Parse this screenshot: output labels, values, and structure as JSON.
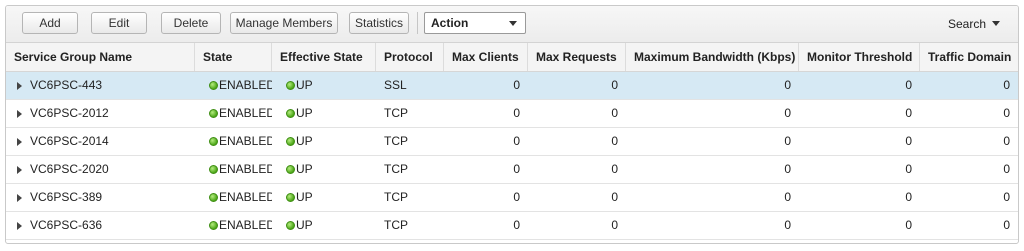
{
  "toolbar": {
    "add_label": "Add",
    "edit_label": "Edit",
    "delete_label": "Delete",
    "manage_members_label": "Manage Members",
    "statistics_label": "Statistics",
    "action_label": "Action",
    "search_label": "Search"
  },
  "table": {
    "columns": [
      "Service Group Name",
      "State",
      "Effective State",
      "Protocol",
      "Max Clients",
      "Max Requests",
      "Maximum Bandwidth (Kbps)",
      "Monitor Threshold",
      "Traffic Domain"
    ],
    "rows": [
      {
        "name": "VC6PSC-443",
        "state": "ENABLED",
        "effective_state": "UP",
        "protocol": "SSL",
        "max_clients": "0",
        "max_requests": "0",
        "max_bandwidth": "0",
        "monitor_threshold": "0",
        "traffic_domain": "0",
        "selected": true
      },
      {
        "name": "VC6PSC-2012",
        "state": "ENABLED",
        "effective_state": "UP",
        "protocol": "TCP",
        "max_clients": "0",
        "max_requests": "0",
        "max_bandwidth": "0",
        "monitor_threshold": "0",
        "traffic_domain": "0",
        "selected": false
      },
      {
        "name": "VC6PSC-2014",
        "state": "ENABLED",
        "effective_state": "UP",
        "protocol": "TCP",
        "max_clients": "0",
        "max_requests": "0",
        "max_bandwidth": "0",
        "monitor_threshold": "0",
        "traffic_domain": "0",
        "selected": false
      },
      {
        "name": "VC6PSC-2020",
        "state": "ENABLED",
        "effective_state": "UP",
        "protocol": "TCP",
        "max_clients": "0",
        "max_requests": "0",
        "max_bandwidth": "0",
        "monitor_threshold": "0",
        "traffic_domain": "0",
        "selected": false
      },
      {
        "name": "VC6PSC-389",
        "state": "ENABLED",
        "effective_state": "UP",
        "protocol": "TCP",
        "max_clients": "0",
        "max_requests": "0",
        "max_bandwidth": "0",
        "monitor_threshold": "0",
        "traffic_domain": "0",
        "selected": false
      },
      {
        "name": "VC6PSC-636",
        "state": "ENABLED",
        "effective_state": "UP",
        "protocol": "TCP",
        "max_clients": "0",
        "max_requests": "0",
        "max_bandwidth": "0",
        "monitor_threshold": "0",
        "traffic_domain": "0",
        "selected": false
      }
    ]
  },
  "icons": {
    "row_expander": "triangle-right-icon",
    "state_indicator": "green-status-dot-icon",
    "dropdown": "caret-down-icon"
  },
  "colors": {
    "selected_row": "#d6e9f4",
    "status_up": "#4ca618"
  }
}
